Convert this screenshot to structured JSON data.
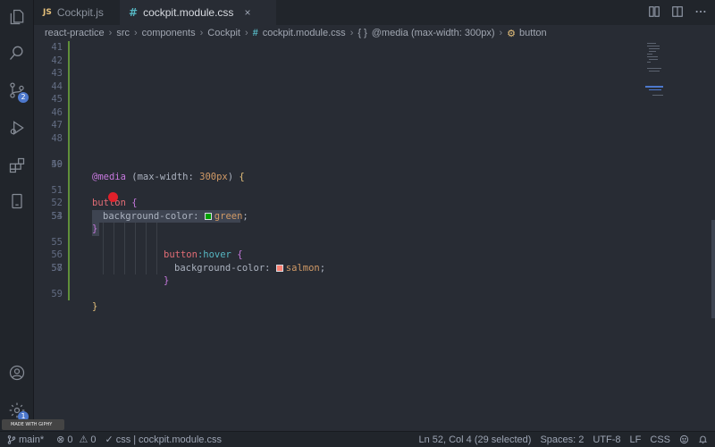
{
  "tabs": [
    {
      "label": "Cockpit.js",
      "icon": "js-file-icon",
      "icon_text": "JS",
      "active": false
    },
    {
      "label": "cockpit.module.css",
      "icon": "css-file-icon",
      "icon_text": "#",
      "active": true,
      "close": "×"
    }
  ],
  "breadcrumb": {
    "items": [
      "react-practice",
      "src",
      "components",
      "Cockpit"
    ],
    "file": "cockpit.module.css",
    "file_icon": "#",
    "media": "@media (max-width: 300px)",
    "media_icon": "{ }",
    "symbol": "button"
  },
  "editor": {
    "line_numbers": [
      "41",
      "42",
      "43",
      "44",
      "45",
      "46",
      "47",
      "48",
      "49",
      "50",
      "51",
      "52",
      "53",
      "54",
      "55",
      "56",
      "57",
      "58",
      "59"
    ],
    "line49": {
      "at": "@media",
      "open": " (max-width: ",
      "num": "300px",
      "close": ") ",
      "brace": "{"
    },
    "line51": {
      "sel": "button",
      "brace": " {"
    },
    "line52": {
      "prop": "background-color: ",
      "value": "green",
      "semi": ";"
    },
    "line53": {
      "brace": "}"
    },
    "line55": {
      "sel": "button",
      "pseudo": ":hover",
      "brace": " {"
    },
    "line56": {
      "prop": "background-color: ",
      "value": "salmon",
      "semi": ";"
    },
    "line57": {
      "brace": "}"
    },
    "line59": {
      "brace": "}"
    },
    "colors": {
      "green": "#00a000",
      "salmon": "#fa8072"
    }
  },
  "activity": {
    "source_control_badge": "2",
    "settings_badge": "1"
  },
  "statusbar": {
    "branch": "main*",
    "errors": "0",
    "warnings": "0",
    "check": "✓",
    "language_mode": "css",
    "file": "cockpit.module.css",
    "position": "Ln 52, Col 4 (29 selected)",
    "spaces": "Spaces: 2",
    "encoding": "UTF-8",
    "eol": "LF",
    "language": "CSS",
    "giphy": "MADE WITH GIPHY"
  }
}
